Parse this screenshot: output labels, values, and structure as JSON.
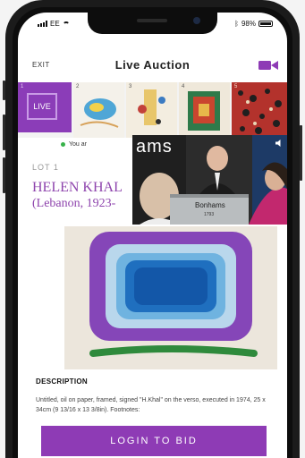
{
  "status_bar": {
    "carrier": "EE",
    "battery": "98%"
  },
  "header": {
    "exit_label": "EXIT",
    "title": "Live Auction",
    "video_icon": "video-camera-icon"
  },
  "lot_strip": {
    "live_label": "LIVE",
    "thumbnails": [
      {
        "number": "1"
      },
      {
        "number": "2"
      },
      {
        "number": "3"
      },
      {
        "number": "4"
      },
      {
        "number": "5"
      }
    ]
  },
  "notice": {
    "text": "You ar"
  },
  "lot": {
    "lot_label": "LOT 1",
    "artist_name": "HELEN KHAL",
    "artist_origin": "(Lebanon, 1923-"
  },
  "video_feed": {
    "overlay_text": "ams",
    "lectern_brand": "Bonhams",
    "lectern_sub": "1793"
  },
  "description": {
    "heading": "DESCRIPTION",
    "body": "Untitled, oil on paper, framed, signed \"H.Khal\" on the verso, executed in 1974, 25 x 34cm (9 13/16 x 13 3/8in). Footnotes:"
  },
  "login_button": {
    "label": "LOGIN TO BID"
  },
  "colors": {
    "brand_purple": "#8e3bb5",
    "artist_purple": "#8e44ad",
    "live_indicator": "#38b24a"
  }
}
